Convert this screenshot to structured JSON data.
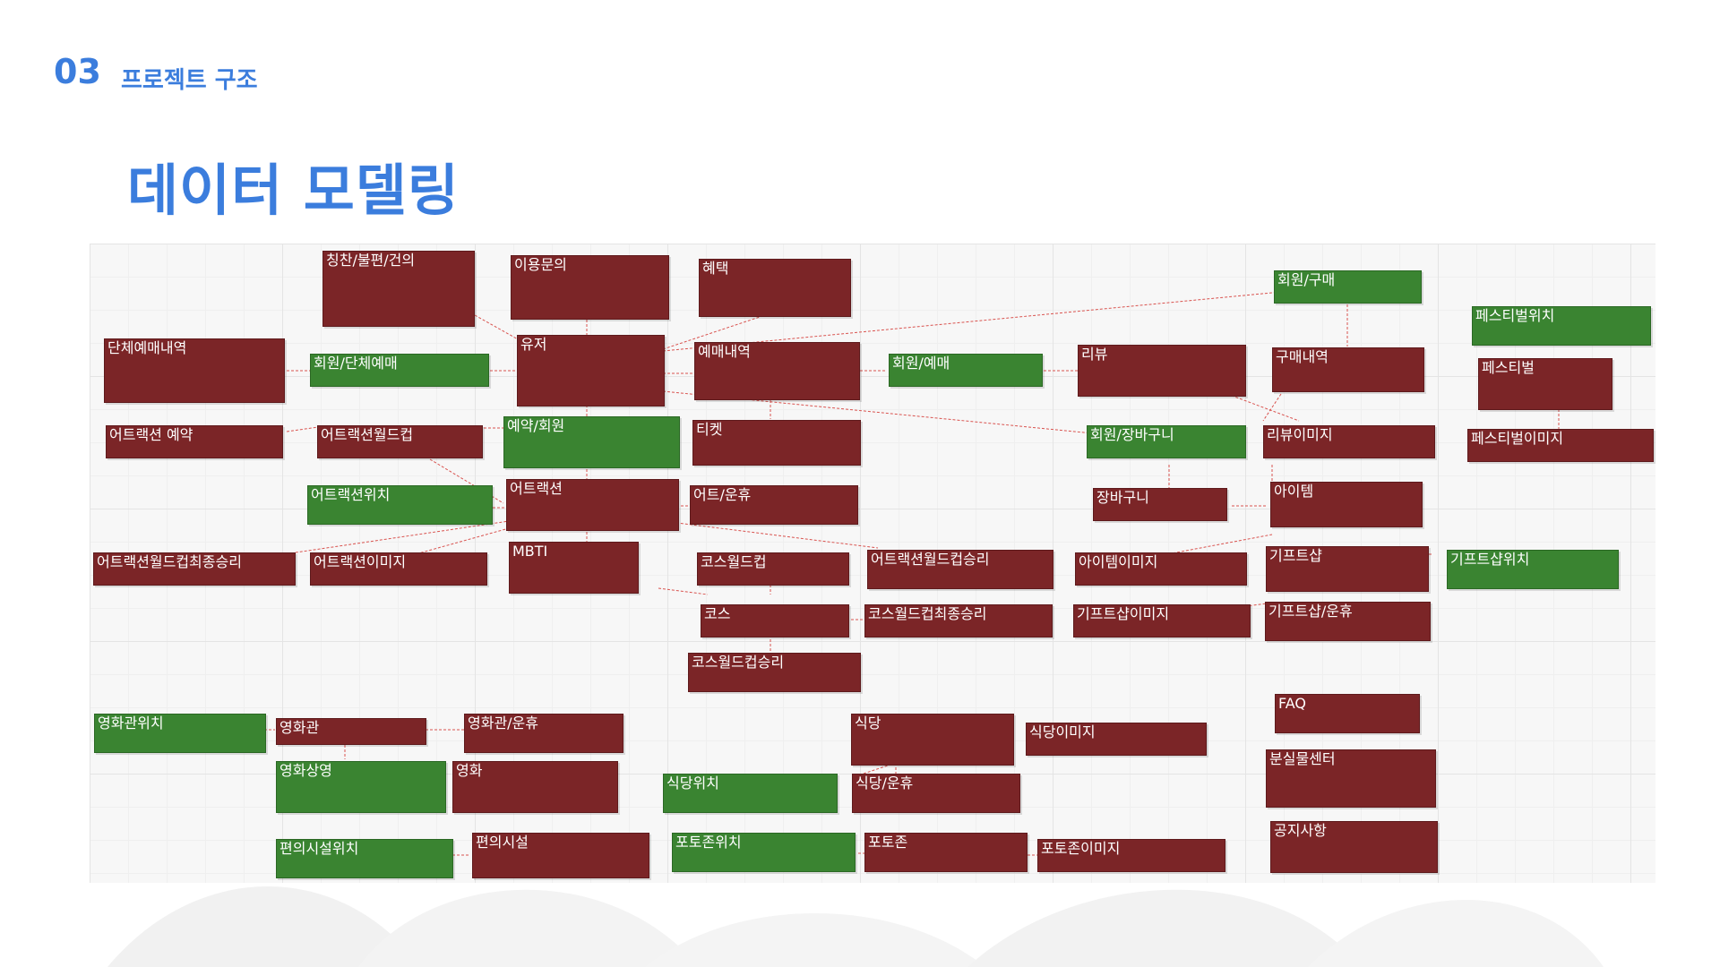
{
  "header": {
    "section_number": "03",
    "section_title": "프로젝트 구조",
    "page_title": "데이터 모델링"
  },
  "colors": {
    "accent": "#3b7ddd",
    "entity_red": "#7b2527",
    "entity_green": "#3a8431",
    "connector": "#d9534f"
  },
  "entities": {
    "praise": "칭찬/불편/건의",
    "inquiry": "이용문의",
    "benefit": "혜택",
    "member_purchase": "회원/구매",
    "festival_location": "페스티벌위치",
    "group_booking_history": "단체예매내역",
    "member_group_booking": "회원/단체예매",
    "user": "유저",
    "booking_history": "예매내역",
    "member_booking": "회원/예매",
    "review": "리뷰",
    "purchase_history": "구매내역",
    "festival": "페스티벌",
    "attraction_reservation": "어트랙션 예약",
    "attraction_worldcup": "어트랙션월드컵",
    "reservation_member": "예약/회원",
    "ticket": "티켓",
    "member_cart": "회원/장바구니",
    "review_image": "리뷰이미지",
    "festival_image": "페스티벌이미지",
    "attraction_location": "어트랙션위치",
    "attraction": "어트랙션",
    "attraction_suspend": "어트/운휴",
    "cart": "장바구니",
    "item": "아이템",
    "worldcup_final_win": "어트랙션월드컵최종승리",
    "attraction_image": "어트랙션이미지",
    "mbti": "MBTI",
    "course_worldcup": "코스월드컵",
    "attraction_worldcup_win": "어트랙션월드컵승리",
    "item_image": "아이템이미지",
    "gift_shop": "기프트샵",
    "gift_shop_location": "기프트샵위치",
    "course": "코스",
    "course_worldcup_final_win": "코스월드컵최종승리",
    "gift_shop_image": "기프트샵이미지",
    "gift_shop_suspend": "기프트샵/운휴",
    "course_worldcup_win": "코스월드컵승리",
    "faq": "FAQ",
    "cinema_location": "영화관위치",
    "cinema": "영화관",
    "cinema_suspend": "영화관/운휴",
    "restaurant": "식당",
    "restaurant_image": "식당이미지",
    "lost_found": "분실물센터",
    "screening": "영화상영",
    "movie": "영화",
    "restaurant_location": "식당위치",
    "restaurant_suspend": "식당/운휴",
    "notice": "공지사항",
    "facility_location": "편의시설위치",
    "facility": "편의시설",
    "photozone_location": "포토존위치",
    "photozone": "포토존",
    "photozone_image": "포토존이미지"
  }
}
